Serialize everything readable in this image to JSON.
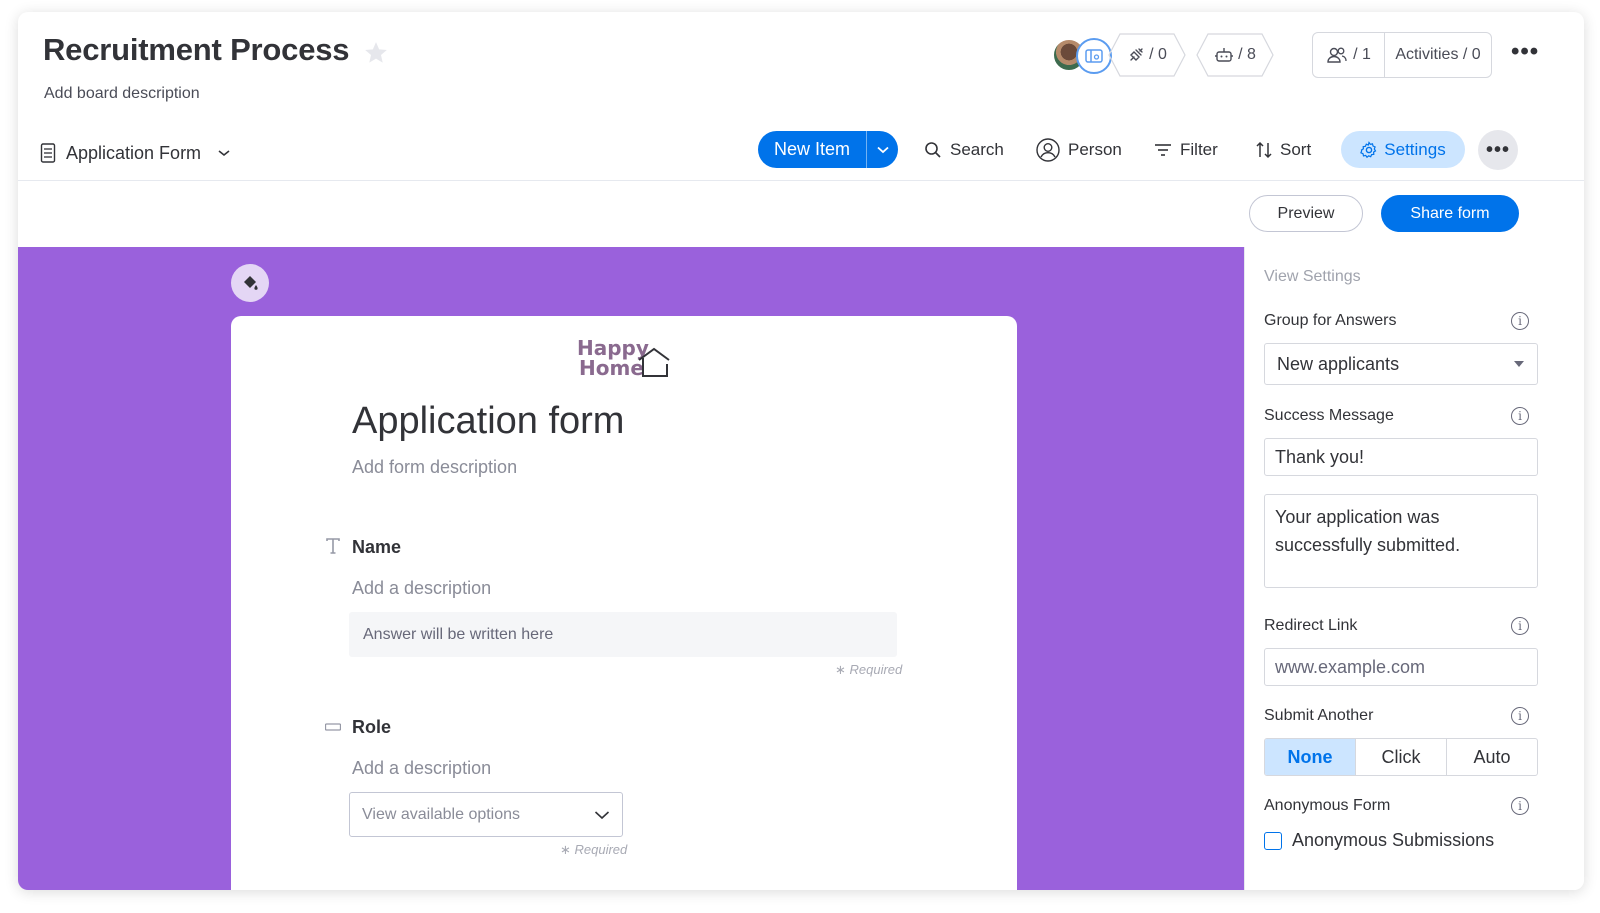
{
  "board": {
    "title": "Recruitment Process",
    "description": "Add board description"
  },
  "header_stats": {
    "integrations": "/ 0",
    "automations": "/ 8",
    "members": "/ 1",
    "activities": "Activities / 0"
  },
  "toolbar": {
    "view_name": "Application Form",
    "new_item": "New Item",
    "search": "Search",
    "person": "Person",
    "filter": "Filter",
    "sort": "Sort",
    "settings": "Settings"
  },
  "actions": {
    "preview": "Preview",
    "share_form": "Share form"
  },
  "form": {
    "logo_line1": "Happy",
    "logo_line2": "Home",
    "title": "Application form",
    "description": "Add form description",
    "questions": [
      {
        "label": "Name",
        "description": "Add a description",
        "placeholder": "Answer will be written here",
        "required": "Required"
      },
      {
        "label": "Role",
        "description": "Add a description",
        "placeholder": "View available options",
        "required": "Required"
      }
    ]
  },
  "view_settings": {
    "title": "View Settings",
    "group_label": "Group for Answers",
    "group_value": "New applicants",
    "success_label": "Success Message",
    "success_title": "Thank you!",
    "success_body": "Your application was successfully submitted.",
    "redirect_label": "Redirect Link",
    "redirect_placeholder": "www.example.com",
    "submit_another_label": "Submit Another",
    "submit_options": [
      "None",
      "Click",
      "Auto"
    ],
    "submit_selected": "None",
    "anonymous_label": "Anonymous Form",
    "anonymous_checkbox": "Anonymous Submissions",
    "anonymous_checked": false
  },
  "colors": {
    "primary": "#0073ea",
    "form_background": "#9a61dc",
    "settings_bg": "#cce5ff"
  }
}
